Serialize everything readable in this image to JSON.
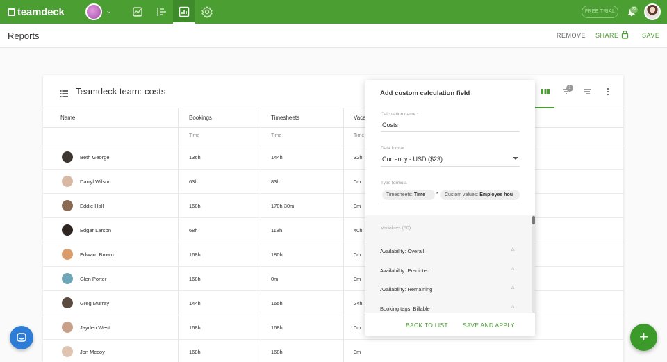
{
  "app": {
    "logo": "teamdeck"
  },
  "topbar": {
    "free_trial": "FREE TRIAL",
    "notification_count": "22"
  },
  "header": {
    "title": "Reports",
    "remove": "REMOVE",
    "share": "SHARE",
    "save": "SAVE"
  },
  "report": {
    "title": "Teamdeck team: costs",
    "filter_count": "1",
    "columns": [
      {
        "label": "Name",
        "sub": ""
      },
      {
        "label": "Bookings",
        "sub": "Time"
      },
      {
        "label": "Timesheets",
        "sub": "Time"
      },
      {
        "label": "Vaca",
        "sub": "Time"
      }
    ],
    "rows": [
      {
        "name": "Beth George",
        "bookings": "136h",
        "timesheets": "144h",
        "vacations": "32h"
      },
      {
        "name": "Darryl Wilson",
        "bookings": "63h",
        "timesheets": "83h",
        "vacations": "0m"
      },
      {
        "name": "Eddie Hall",
        "bookings": "168h",
        "timesheets": "170h 30m",
        "vacations": "0m"
      },
      {
        "name": "Edgar Larson",
        "bookings": "68h",
        "timesheets": "118h",
        "vacations": "40h"
      },
      {
        "name": "Edward Brown",
        "bookings": "168h",
        "timesheets": "180h",
        "vacations": "0m"
      },
      {
        "name": "Glen Porter",
        "bookings": "168h",
        "timesheets": "0m",
        "vacations": "0m"
      },
      {
        "name": "Greg Murray",
        "bookings": "144h",
        "timesheets": "165h",
        "vacations": "24h"
      },
      {
        "name": "Jayden West",
        "bookings": "168h",
        "timesheets": "168h",
        "vacations": "0m"
      },
      {
        "name": "Jon Mccoy",
        "bookings": "168h",
        "timesheets": "168h",
        "vacations": "0m"
      }
    ]
  },
  "panel": {
    "title": "Add custom calculation field",
    "calc_name_label": "Calculation name *",
    "calc_name_value": "Costs",
    "data_format_label": "Data format",
    "data_format_value": "Currency - USD ($23)",
    "formula_label": "Type formula",
    "formula_chip1_prefix": "Timesheets: ",
    "formula_chip1_value": "Time",
    "formula_operator": "*",
    "formula_chip2_prefix": "Custom values: ",
    "formula_chip2_value": "Employee hou",
    "variables_label": "Variables (50)",
    "variables": [
      "Availability: Overall",
      "Availability: Predicted",
      "Availability: Remaining",
      "Booking tags: Billable"
    ],
    "back": "BACK TO LIST",
    "save_apply": "SAVE AND APPLY"
  },
  "fab": {
    "label": "+"
  },
  "colors": {
    "brand_green": "#4a9e32",
    "chat_blue": "#2d7cd5"
  }
}
